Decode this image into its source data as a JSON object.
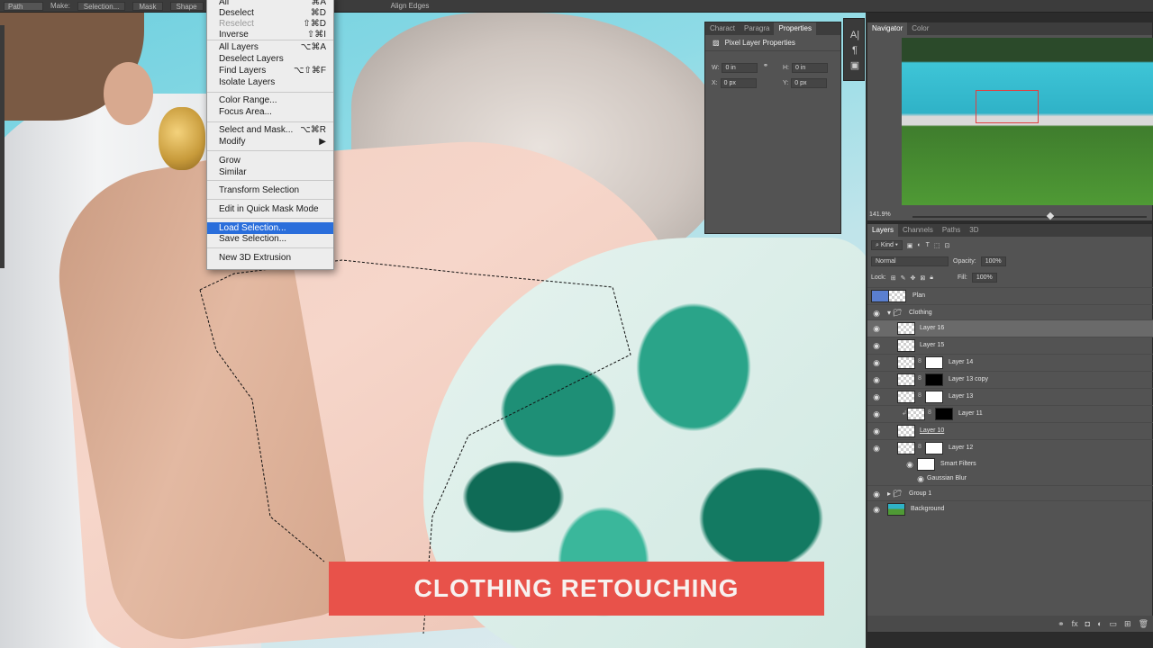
{
  "options_bar": {
    "tool_select": "Path",
    "make_label": "Make:",
    "selection_button": "Selection...",
    "mask_button": "Mask",
    "shape_button": "Shape",
    "align_edges": "Align Edges"
  },
  "select_menu": {
    "items": [
      {
        "label": "All",
        "shortcut": "⌘A",
        "disabled": false
      },
      {
        "label": "Deselect",
        "shortcut": "⌘D",
        "disabled": false
      },
      {
        "label": "Reselect",
        "shortcut": "⇧⌘D",
        "disabled": true
      },
      {
        "label": "Inverse",
        "shortcut": "⇧⌘I",
        "disabled": false
      },
      {
        "label": "All Layers",
        "shortcut": "⌥⌘A",
        "disabled": false
      },
      {
        "label": "Deselect Layers",
        "shortcut": "",
        "disabled": false
      },
      {
        "label": "Find Layers",
        "shortcut": "⌥⇧⌘F",
        "disabled": false
      },
      {
        "label": "Isolate Layers",
        "shortcut": "",
        "disabled": false
      },
      {
        "label": "Color Range...",
        "shortcut": "",
        "disabled": false
      },
      {
        "label": "Focus Area...",
        "shortcut": "",
        "disabled": false
      },
      {
        "label": "Select and Mask...",
        "shortcut": "⌥⌘R",
        "disabled": false
      },
      {
        "label": "Modify",
        "shortcut": "▶",
        "disabled": false
      },
      {
        "label": "Grow",
        "shortcut": "",
        "disabled": false
      },
      {
        "label": "Similar",
        "shortcut": "",
        "disabled": false
      },
      {
        "label": "Transform Selection",
        "shortcut": "",
        "disabled": false
      },
      {
        "label": "Edit in Quick Mask Mode",
        "shortcut": "",
        "disabled": false
      },
      {
        "label": "Load Selection...",
        "shortcut": "",
        "disabled": false,
        "highlighted": true
      },
      {
        "label": "Save Selection...",
        "shortcut": "",
        "disabled": false
      },
      {
        "label": "New 3D Extrusion",
        "shortcut": "",
        "disabled": false
      }
    ]
  },
  "properties_panel": {
    "tabs": [
      "Charact",
      "Paragra",
      "Properties"
    ],
    "active_tab": "Properties",
    "title": "Pixel Layer Properties",
    "w_label": "W:",
    "w_value": "0 in",
    "h_label": "H:",
    "h_value": "0 in",
    "x_label": "X:",
    "x_value": "0 px",
    "y_label": "Y:",
    "y_value": "0 px"
  },
  "navigator_panel": {
    "tabs": [
      "Navigator",
      "Color"
    ],
    "active_tab": "Navigator",
    "zoom": "141.9%"
  },
  "layers_panel": {
    "tabs": [
      "Layers",
      "Channels",
      "Paths",
      "3D"
    ],
    "active_tab": "Layers",
    "filter_kind": "Kind",
    "blend_mode": "Normal",
    "opacity_label": "Opacity:",
    "opacity_value": "100%",
    "lock_label": "Lock:",
    "fill_label": "Fill:",
    "fill_value": "100%",
    "layers": [
      {
        "name": "Plan"
      },
      {
        "name": "Clothing"
      },
      {
        "name": "Layer 16"
      },
      {
        "name": "Layer 15"
      },
      {
        "name": "Layer 14"
      },
      {
        "name": "Layer 13 copy"
      },
      {
        "name": "Layer 13"
      },
      {
        "name": "Layer 11"
      },
      {
        "name": "Layer 10"
      },
      {
        "name": "Layer 12"
      },
      {
        "name": "Smart Filters"
      },
      {
        "name": "Gaussian Blur"
      },
      {
        "name": "Group 1"
      },
      {
        "name": "Background"
      }
    ]
  },
  "banner": {
    "title": "CLOTHING RETOUCHING"
  },
  "colors": {
    "menu_highlight": "#2a6edb",
    "banner": "#e8524a",
    "panel": "#535353"
  }
}
